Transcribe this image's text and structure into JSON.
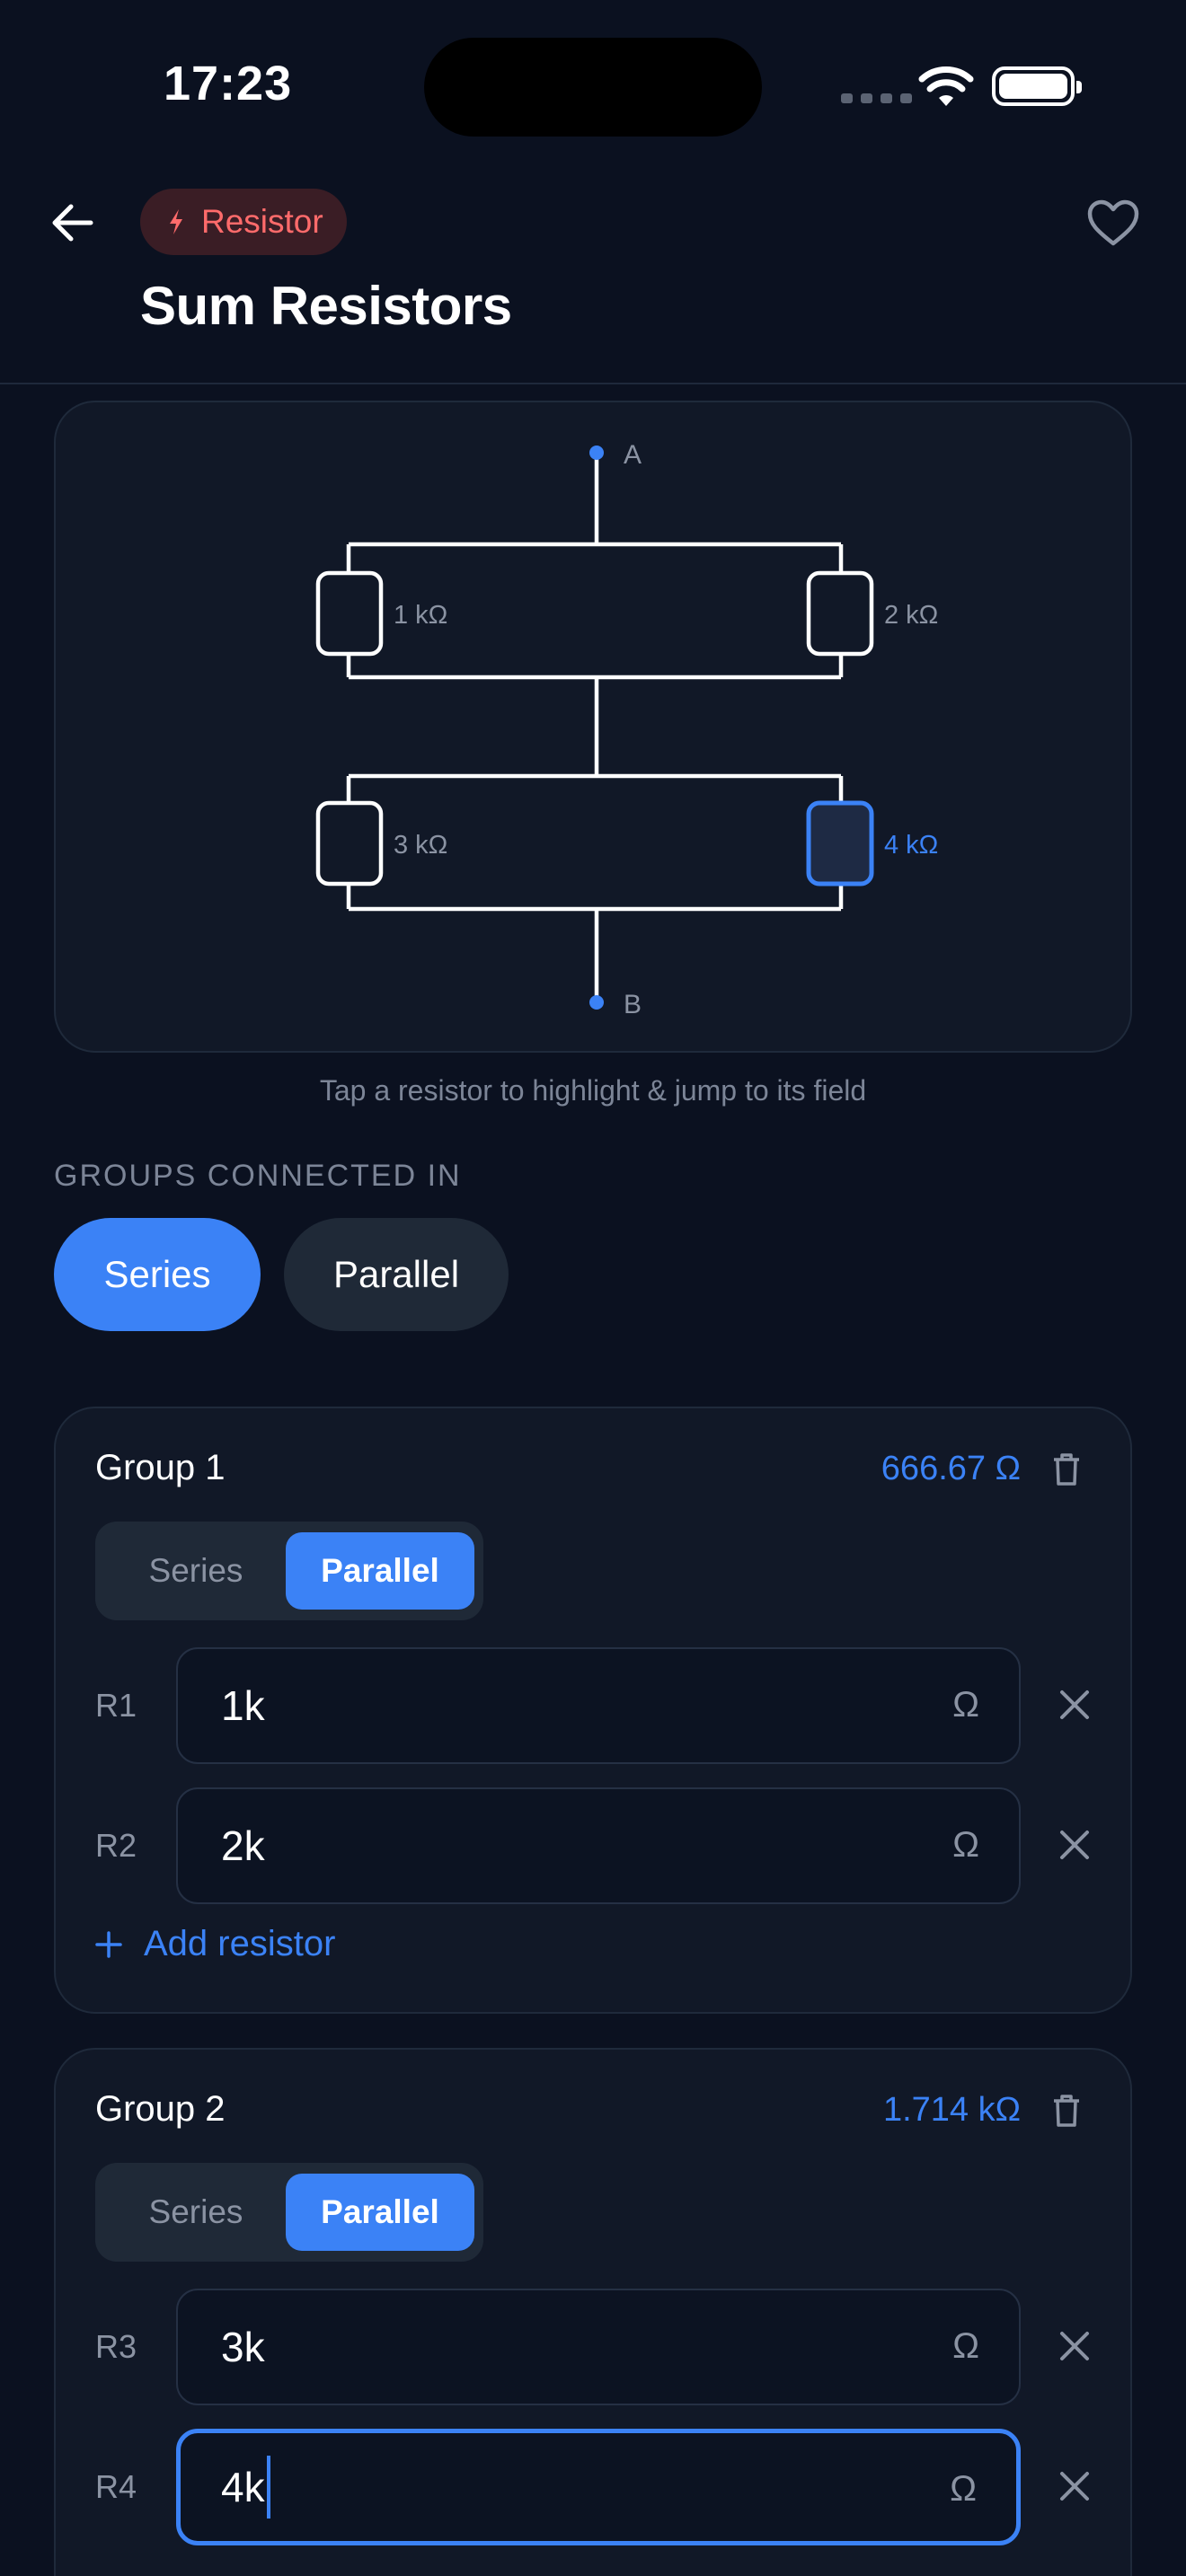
{
  "status_bar": {
    "time": "17:23"
  },
  "header": {
    "chip_label": "Resistor",
    "title": "Sum Resistors"
  },
  "diagram": {
    "node_a": "A",
    "node_b": "B",
    "resistor_labels": [
      "1 kΩ",
      "2 kΩ",
      "3 kΩ",
      "4 kΩ"
    ],
    "highlighted": "R4",
    "hint": "Tap a resistor to highlight & jump to its field"
  },
  "connection": {
    "section_label": "GROUPS CONNECTED IN",
    "options": [
      "Series",
      "Parallel"
    ],
    "selected": "Series"
  },
  "groups": [
    {
      "name": "Group 1",
      "total": "666.67 Ω",
      "mode_options": [
        "Series",
        "Parallel"
      ],
      "mode": "Parallel",
      "resistors": [
        {
          "label": "R1",
          "value": "1k",
          "unit": "Ω"
        },
        {
          "label": "R2",
          "value": "2k",
          "unit": "Ω"
        }
      ],
      "add_label": "Add resistor"
    },
    {
      "name": "Group 2",
      "total": "1.714 kΩ",
      "mode_options": [
        "Series",
        "Parallel"
      ],
      "mode": "Parallel",
      "resistors": [
        {
          "label": "R3",
          "value": "3k",
          "unit": "Ω"
        },
        {
          "label": "R4",
          "value": "4k",
          "unit": "Ω"
        }
      ]
    }
  ],
  "colors": {
    "accent": "#3b82f6",
    "background": "#0b1120",
    "chip_text": "#ff6b6b",
    "muted_text": "#7c8597"
  }
}
